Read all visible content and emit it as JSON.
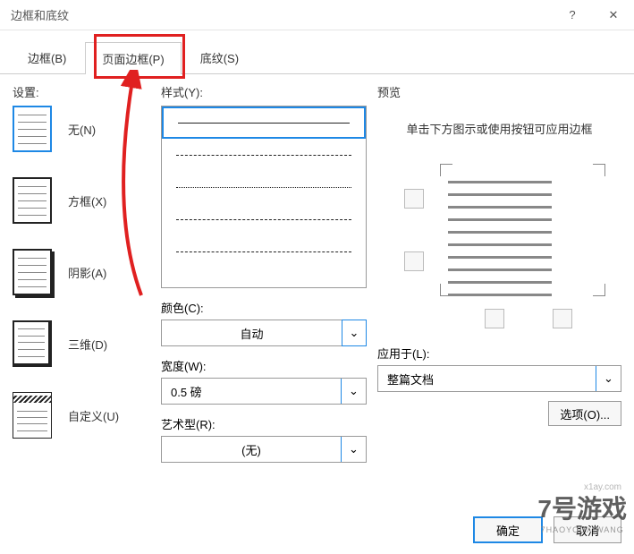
{
  "titlebar": {
    "title": "边框和底纹"
  },
  "tabs": {
    "border": "边框(B)",
    "page_border": "页面边框(P)",
    "shading": "底纹(S)"
  },
  "left": {
    "header": "设置:",
    "none": "无(N)",
    "box": "方框(X)",
    "shadow": "阴影(A)",
    "three_d": "三维(D)",
    "custom": "自定义(U)"
  },
  "mid": {
    "style": "样式(Y):",
    "color": "颜色(C):",
    "color_val": "自动",
    "width": "宽度(W):",
    "width_val": "0.5 磅",
    "art": "艺术型(R):",
    "art_val": "(无)"
  },
  "right": {
    "preview": "预览",
    "hint": "单击下方图示或使用按钮可应用边框",
    "apply": "应用于(L):",
    "apply_val": "整篇文档",
    "options": "选项(O)..."
  },
  "footer": {
    "ok": "确定",
    "cancel": "取消"
  },
  "watermark": {
    "main": "7号游戏",
    "sub": "7HAOYOUXIWANG",
    "host": "x1ay.com"
  }
}
